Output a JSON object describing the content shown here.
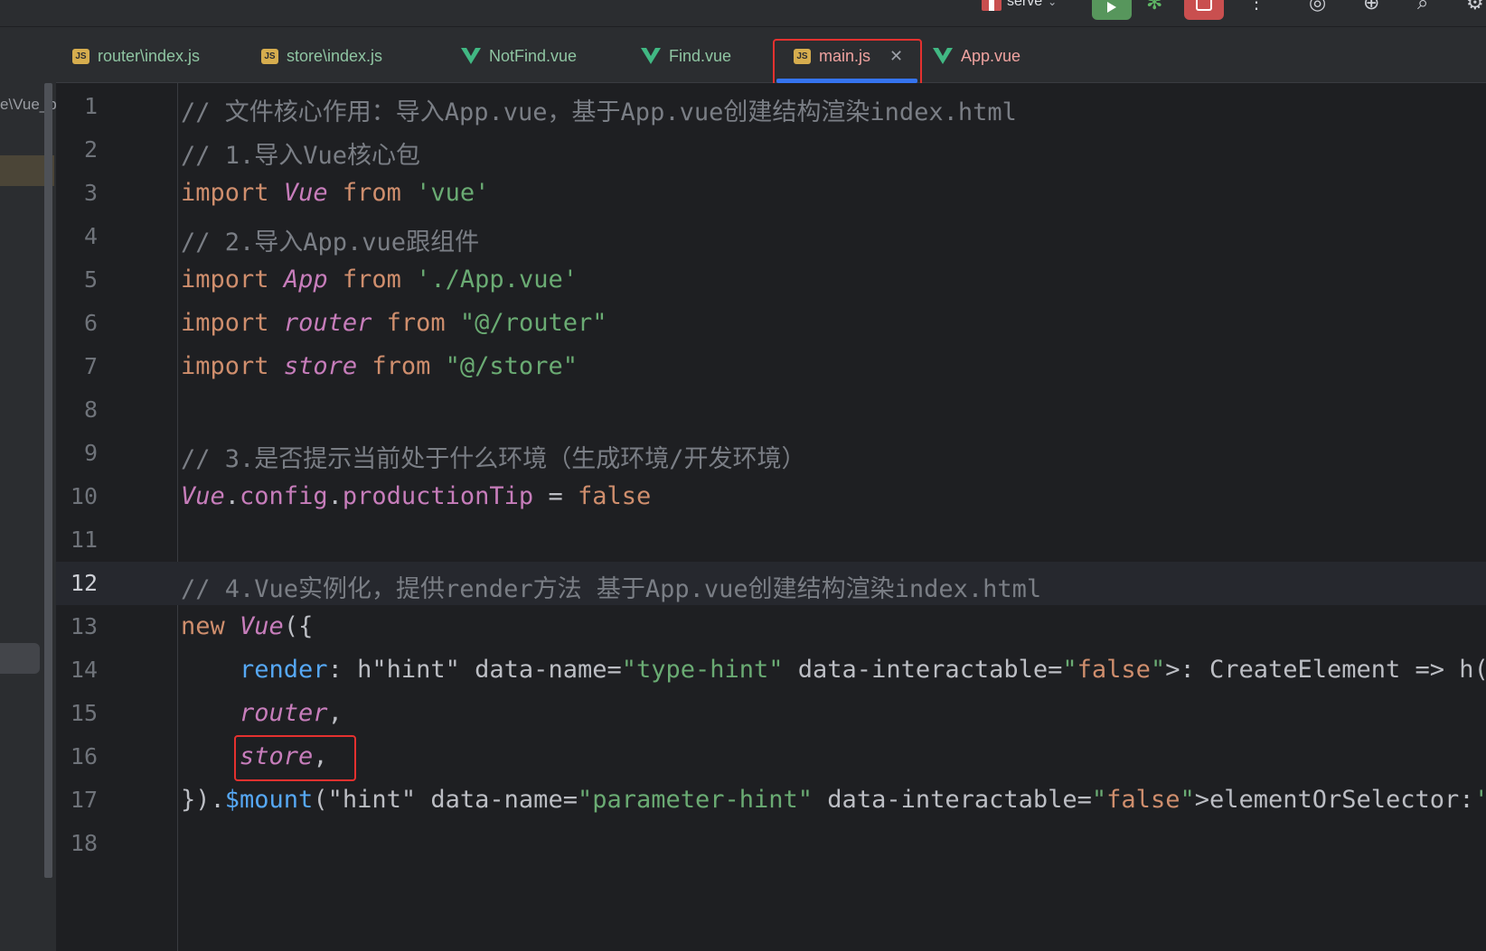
{
  "toolbar": {
    "run_config": "serve"
  },
  "project_panel": {
    "path_fragment": "e\\Vue_p"
  },
  "tabs": [
    {
      "label": "router\\index.js",
      "type": "js",
      "active": false
    },
    {
      "label": "store\\index.js",
      "type": "js",
      "active": false
    },
    {
      "label": "NotFind.vue",
      "type": "vue",
      "active": false
    },
    {
      "label": "Find.vue",
      "type": "vue",
      "active": false
    },
    {
      "label": "main.js",
      "type": "js",
      "active": true
    },
    {
      "label": "App.vue",
      "type": "vue",
      "active": false
    }
  ],
  "editor": {
    "current_line": 12,
    "lines": [
      {
        "n": "1",
        "text": "// 文件核心作用：导入App.vue，基于App.vue创建结构渲染index.html"
      },
      {
        "n": "2",
        "text": "// 1.导入Vue核心包"
      },
      {
        "n": "3",
        "text": "import Vue from 'vue'"
      },
      {
        "n": "4",
        "text": "// 2.导入App.vue跟组件"
      },
      {
        "n": "5",
        "text": "import App from './App.vue'"
      },
      {
        "n": "6",
        "text": "import router from \"@/router\""
      },
      {
        "n": "7",
        "text": "import store from \"@/store\""
      },
      {
        "n": "8",
        "text": ""
      },
      {
        "n": "9",
        "text": "// 3.是否提示当前处于什么环境（生成环境/开发环境）"
      },
      {
        "n": "10",
        "text": "Vue.config.productionTip = false"
      },
      {
        "n": "11",
        "text": ""
      },
      {
        "n": "12",
        "text": "// 4.Vue实例化，提供render方法 基于App.vue创建结构渲染index.html"
      },
      {
        "n": "13",
        "text": "new Vue({"
      },
      {
        "n": "14",
        "text": "    render: h : CreateElement  => h(App),"
      },
      {
        "n": "15",
        "text": "    router,"
      },
      {
        "n": "16",
        "text": "    store,"
      },
      {
        "n": "17",
        "text": "}).$mount( elementOrSelector: '#app')"
      },
      {
        "n": "18",
        "text": ""
      }
    ],
    "hints": {
      "create_element": ": CreateElement",
      "element_or_selector": "elementOrSelector:"
    }
  },
  "colors": {
    "annotation_box": "#e5312f",
    "active_tab_underline": "#3574f0",
    "keyword": "#cf8e6d",
    "string": "#6aab73",
    "comment": "#7a7e85",
    "italic_identifier": "#c77dbb"
  }
}
